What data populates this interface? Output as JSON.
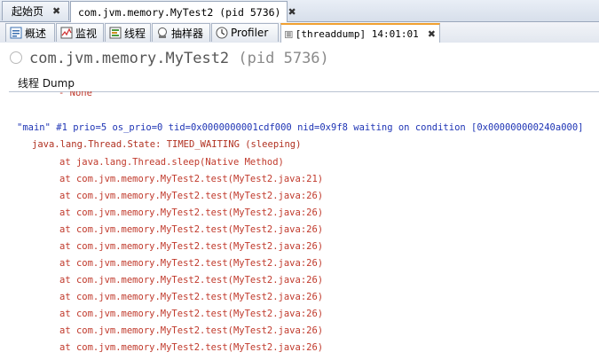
{
  "doc_tabs": [
    {
      "label": "起始页",
      "active": false
    },
    {
      "label": "com.jvm.memory.MyTest2 (pid 5736)",
      "active": true
    }
  ],
  "sub_tabs": [
    {
      "label": "概述",
      "icon": "overview-icon"
    },
    {
      "label": "监视",
      "icon": "monitor-icon"
    },
    {
      "label": "线程",
      "icon": "threads-icon"
    },
    {
      "label": "抽样器",
      "icon": "sampler-icon"
    },
    {
      "label": "Profiler",
      "icon": "profiler-icon"
    },
    {
      "label": "[threaddump] 14:01:01",
      "icon": "threaddump-icon",
      "active": true
    }
  ],
  "header": {
    "app_name": "com.jvm.memory.MyTest2",
    "pid": "(pid 5736)"
  },
  "section": {
    "title": "线程 Dump"
  },
  "dump": {
    "top_partial": "- None",
    "thread_line": "\"main\" #1 prio=5 os_prio=0 tid=0x0000000001cdf000 nid=0x9f8 waiting on condition [0x000000000240a000]",
    "state_line": "java.lang.Thread.State: TIMED_WAITING (sleeping)",
    "frames": [
      "at java.lang.Thread.sleep(Native Method)",
      "at com.jvm.memory.MyTest2.test(MyTest2.java:21)",
      "at com.jvm.memory.MyTest2.test(MyTest2.java:26)",
      "at com.jvm.memory.MyTest2.test(MyTest2.java:26)",
      "at com.jvm.memory.MyTest2.test(MyTest2.java:26)",
      "at com.jvm.memory.MyTest2.test(MyTest2.java:26)",
      "at com.jvm.memory.MyTest2.test(MyTest2.java:26)",
      "at com.jvm.memory.MyTest2.test(MyTest2.java:26)",
      "at com.jvm.memory.MyTest2.test(MyTest2.java:26)",
      "at com.jvm.memory.MyTest2.test(MyTest2.java:26)",
      "at com.jvm.memory.MyTest2.test(MyTest2.java:26)",
      "at com.jvm.memory.MyTest2.test(MyTest2.java:26)"
    ]
  },
  "colors": {
    "frame_text": "#c0392b",
    "thread_header": "#1f35b5",
    "active_tab_accent": "#f0a030"
  }
}
